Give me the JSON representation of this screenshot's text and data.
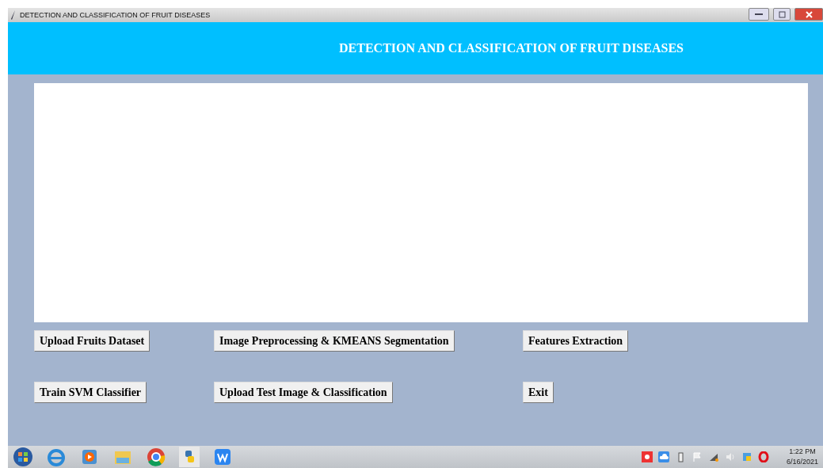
{
  "window": {
    "title": "DETECTION AND CLASSIFICATION OF FRUIT DISEASES"
  },
  "header": {
    "title": "DETECTION AND CLASSIFICATION OF FRUIT DISEASES"
  },
  "buttons": [
    {
      "label": "Upload Fruits Dataset"
    },
    {
      "label": "Image Preprocessing & KMEANS Segmentation"
    },
    {
      "label": "Features Extraction"
    },
    {
      "label": "Train SVM Classifier"
    },
    {
      "label": "Upload Test Image & Classification"
    },
    {
      "label": "Exit"
    }
  ],
  "taskbar": {
    "time": "1:22 PM",
    "date": "6/16/2021"
  }
}
